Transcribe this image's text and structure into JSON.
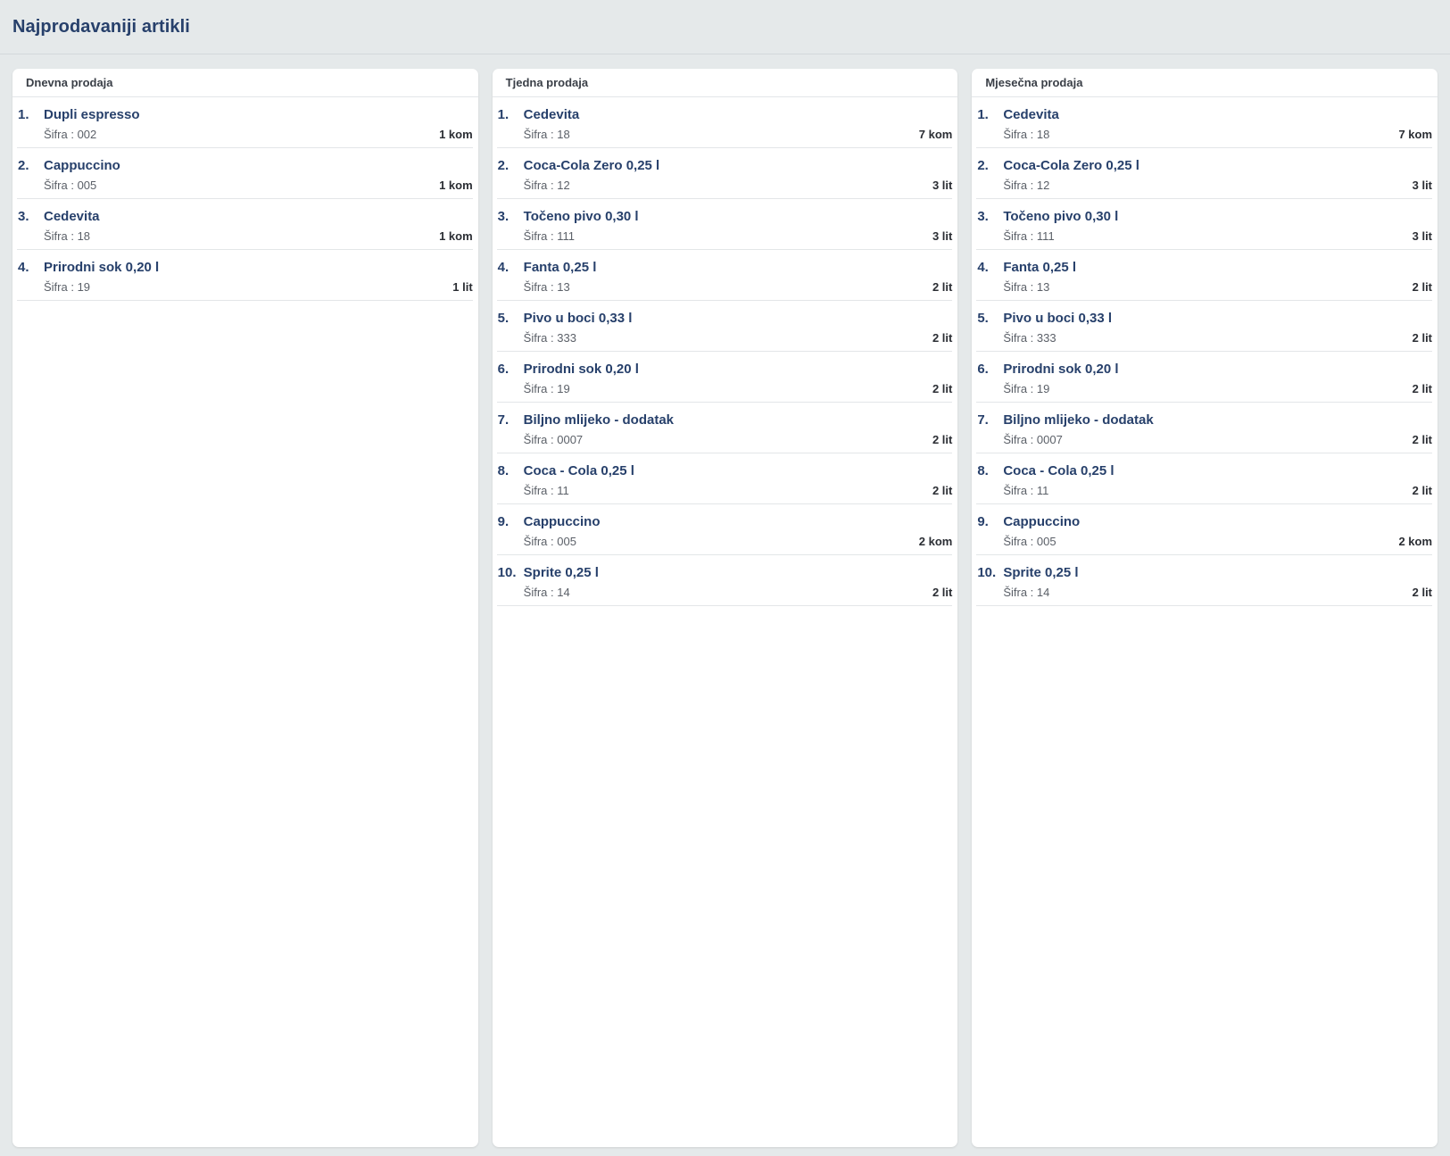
{
  "page": {
    "title": "Najprodavaniji artikli"
  },
  "columns": [
    {
      "header": "Dnevna prodaja",
      "items": [
        {
          "rank": "1.",
          "name": "Dupli espresso",
          "code": "Šifra : 002",
          "qty": "1 kom"
        },
        {
          "rank": "2.",
          "name": "Cappuccino",
          "code": "Šifra : 005",
          "qty": "1 kom"
        },
        {
          "rank": "3.",
          "name": "Cedevita",
          "code": "Šifra : 18",
          "qty": "1 kom"
        },
        {
          "rank": "4.",
          "name": "Prirodni sok 0,20 l",
          "code": "Šifra : 19",
          "qty": "1 lit"
        }
      ]
    },
    {
      "header": "Tjedna prodaja",
      "items": [
        {
          "rank": "1.",
          "name": "Cedevita",
          "code": "Šifra : 18",
          "qty": "7 kom"
        },
        {
          "rank": "2.",
          "name": "Coca-Cola Zero 0,25 l",
          "code": "Šifra : 12",
          "qty": "3 lit"
        },
        {
          "rank": "3.",
          "name": "Točeno pivo 0,30 l",
          "code": "Šifra : 111",
          "qty": "3 lit"
        },
        {
          "rank": "4.",
          "name": "Fanta 0,25 l",
          "code": "Šifra : 13",
          "qty": "2 lit"
        },
        {
          "rank": "5.",
          "name": "Pivo u boci 0,33 l",
          "code": "Šifra : 333",
          "qty": "2 lit"
        },
        {
          "rank": "6.",
          "name": "Prirodni sok 0,20 l",
          "code": "Šifra : 19",
          "qty": "2 lit"
        },
        {
          "rank": "7.",
          "name": "Biljno mlijeko - dodatak",
          "code": "Šifra : 0007",
          "qty": "2 lit"
        },
        {
          "rank": "8.",
          "name": "Coca - Cola 0,25 l",
          "code": "Šifra : 11",
          "qty": "2 lit"
        },
        {
          "rank": "9.",
          "name": "Cappuccino",
          "code": "Šifra : 005",
          "qty": "2 kom"
        },
        {
          "rank": "10.",
          "name": "Sprite 0,25 l",
          "code": "Šifra : 14",
          "qty": "2 lit"
        }
      ]
    },
    {
      "header": "Mjesečna prodaja",
      "items": [
        {
          "rank": "1.",
          "name": "Cedevita",
          "code": "Šifra : 18",
          "qty": "7 kom"
        },
        {
          "rank": "2.",
          "name": "Coca-Cola Zero 0,25 l",
          "code": "Šifra : 12",
          "qty": "3 lit"
        },
        {
          "rank": "3.",
          "name": "Točeno pivo 0,30 l",
          "code": "Šifra : 111",
          "qty": "3 lit"
        },
        {
          "rank": "4.",
          "name": "Fanta 0,25 l",
          "code": "Šifra : 13",
          "qty": "2 lit"
        },
        {
          "rank": "5.",
          "name": "Pivo u boci 0,33 l",
          "code": "Šifra : 333",
          "qty": "2 lit"
        },
        {
          "rank": "6.",
          "name": "Prirodni sok 0,20 l",
          "code": "Šifra : 19",
          "qty": "2 lit"
        },
        {
          "rank": "7.",
          "name": "Biljno mlijeko - dodatak",
          "code": "Šifra : 0007",
          "qty": "2 lit"
        },
        {
          "rank": "8.",
          "name": "Coca - Cola 0,25 l",
          "code": "Šifra : 11",
          "qty": "2 lit"
        },
        {
          "rank": "9.",
          "name": "Cappuccino",
          "code": "Šifra : 005",
          "qty": "2 kom"
        },
        {
          "rank": "10.",
          "name": "Sprite 0,25 l",
          "code": "Šifra : 14",
          "qty": "2 lit"
        }
      ]
    }
  ],
  "colors": {
    "background": "#e5e9ea",
    "card": "#ffffff",
    "title": "#27406b",
    "divider": "#e3e6e8"
  }
}
